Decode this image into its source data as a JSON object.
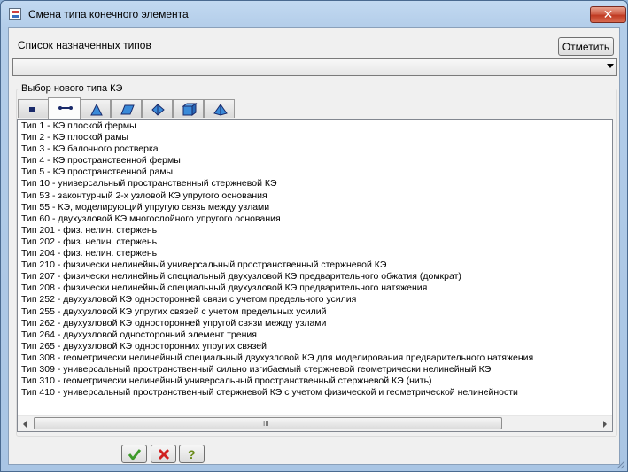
{
  "window": {
    "title": "Смена типа конечного элемента",
    "close_label": "✕"
  },
  "assigned": {
    "label": "Список назначенных типов",
    "unmark_label": "Отметить",
    "selected_value": ""
  },
  "new_type": {
    "label": "Выбор нового  типа  КЭ",
    "tabs": [
      {
        "icon": "square-icon"
      },
      {
        "icon": "bar-element-icon"
      },
      {
        "icon": "plane-element-icon"
      },
      {
        "icon": "shell-element-icon"
      },
      {
        "icon": "solid-element-icon"
      },
      {
        "icon": "cube-element-icon"
      },
      {
        "icon": "tetra-element-icon"
      }
    ],
    "active_tab": 1,
    "items": [
      "Тип 1 - КЭ плоской фермы",
      "Тип 2 - КЭ плоской рамы",
      "Тип 3 - КЭ балочного ростверка",
      "Тип 4 - КЭ пространственной фермы",
      "Тип 5 - КЭ пространственной рамы",
      "Тип 10 - универсальный пространственный стержневой КЭ",
      "Тип 53 - законтурный 2-х узловой КЭ упругого основания",
      "Тип 55 - КЭ, моделирующий упругую связь между узлами",
      "Тип 60 - двухузловой КЭ многослойного упругого основания",
      "Тип 201 -  физ. нелин. стержень",
      "Тип 202 -  физ. нелин. стержень",
      "Тип 204 -  физ. нелин. стержень",
      "Тип 210 - физически нелинейный универсальный пространственный стержневой КЭ",
      "Тип 207 - физически нелинейный специальный двухузловой КЭ предварительного обжатия (домкрат)",
      "Тип 208 - физически нелинейный специальный двухузловой КЭ предварительного натяжения",
      "Тип 252 - двухузловой КЭ односторонней связи с учетом предельного усилия",
      "Тип 255 - двухузловой КЭ упругих связей с учетом предельных усилий",
      "Тип 262 - двухузловой КЭ односторонней упругой связи между узлами",
      "Тип 264 - двухузловой односторонний элемент трения",
      "Тип 265 - двухузловой КЭ односторонних упругих связей",
      "Тип 308 - геометрически нелинейный специальный двухузловой КЭ для моделирования предварительного натяжения",
      "Тип 309 - универсальный пространственный сильно изгибаемый стержневой геометрически нелинейный КЭ",
      "Тип 310 - геометрически нелинейный универсальный пространственный стержневой КЭ (нить)",
      "Тип 410 - универсальный пространственный стержневой КЭ с учетом физической и геометрической нелинейности"
    ],
    "scrollbar_grip": "III"
  },
  "footer": {
    "buttons": [
      {
        "icon": "check-icon",
        "color": "#3d9a2a"
      },
      {
        "icon": "cross-icon",
        "color": "#d02020"
      },
      {
        "icon": "help-icon",
        "color": "#6a8a1a"
      }
    ]
  }
}
